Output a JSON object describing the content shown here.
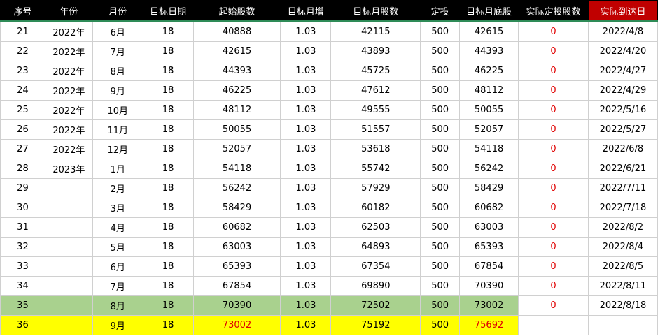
{
  "columns": [
    "序号",
    "年份",
    "月份",
    "目标日期",
    "起始股数",
    "目标月增",
    "目标月股数",
    "定投",
    "目标月底股",
    "实际定投股数",
    "实际到达日"
  ],
  "rows": [
    {
      "seq": "21",
      "year": "2022年",
      "month": "6月",
      "target_date": "18",
      "start_shares": "40888",
      "monthly_growth": "1.03",
      "target_month_shares": "42115",
      "invest": "500",
      "month_end_target": "42615",
      "actual_invest_shares": "0",
      "actual_date": "2022/4/8"
    },
    {
      "seq": "22",
      "year": "2022年",
      "month": "7月",
      "target_date": "18",
      "start_shares": "42615",
      "monthly_growth": "1.03",
      "target_month_shares": "43893",
      "invest": "500",
      "month_end_target": "44393",
      "actual_invest_shares": "0",
      "actual_date": "2022/4/20"
    },
    {
      "seq": "23",
      "year": "2022年",
      "month": "8月",
      "target_date": "18",
      "start_shares": "44393",
      "monthly_growth": "1.03",
      "target_month_shares": "45725",
      "invest": "500",
      "month_end_target": "46225",
      "actual_invest_shares": "0",
      "actual_date": "2022/4/27"
    },
    {
      "seq": "24",
      "year": "2022年",
      "month": "9月",
      "target_date": "18",
      "start_shares": "46225",
      "monthly_growth": "1.03",
      "target_month_shares": "47612",
      "invest": "500",
      "month_end_target": "48112",
      "actual_invest_shares": "0",
      "actual_date": "2022/4/29"
    },
    {
      "seq": "25",
      "year": "2022年",
      "month": "10月",
      "target_date": "18",
      "start_shares": "48112",
      "monthly_growth": "1.03",
      "target_month_shares": "49555",
      "invest": "500",
      "month_end_target": "50055",
      "actual_invest_shares": "0",
      "actual_date": "2022/5/16"
    },
    {
      "seq": "26",
      "year": "2022年",
      "month": "11月",
      "target_date": "18",
      "start_shares": "50055",
      "monthly_growth": "1.03",
      "target_month_shares": "51557",
      "invest": "500",
      "month_end_target": "52057",
      "actual_invest_shares": "0",
      "actual_date": "2022/5/27"
    },
    {
      "seq": "27",
      "year": "2022年",
      "month": "12月",
      "target_date": "18",
      "start_shares": "52057",
      "monthly_growth": "1.03",
      "target_month_shares": "53618",
      "invest": "500",
      "month_end_target": "54118",
      "actual_invest_shares": "0",
      "actual_date": "2022/6/8"
    },
    {
      "seq": "28",
      "year": "2023年",
      "month": "1月",
      "target_date": "18",
      "start_shares": "54118",
      "monthly_growth": "1.03",
      "target_month_shares": "55742",
      "invest": "500",
      "month_end_target": "56242",
      "actual_invest_shares": "0",
      "actual_date": "2022/6/21"
    },
    {
      "seq": "29",
      "year": "",
      "month": "2月",
      "target_date": "18",
      "start_shares": "56242",
      "monthly_growth": "1.03",
      "target_month_shares": "57929",
      "invest": "500",
      "month_end_target": "58429",
      "actual_invest_shares": "0",
      "actual_date": "2022/7/11"
    },
    {
      "seq": "30",
      "year": "",
      "month": "3月",
      "target_date": "18",
      "start_shares": "58429",
      "monthly_growth": "1.03",
      "target_month_shares": "60182",
      "invest": "500",
      "month_end_target": "60682",
      "actual_invest_shares": "0",
      "actual_date": "2022/7/18"
    },
    {
      "seq": "31",
      "year": "",
      "month": "4月",
      "target_date": "18",
      "start_shares": "60682",
      "monthly_growth": "1.03",
      "target_month_shares": "62503",
      "invest": "500",
      "month_end_target": "63003",
      "actual_invest_shares": "0",
      "actual_date": "2022/8/2"
    },
    {
      "seq": "32",
      "year": "",
      "month": "5月",
      "target_date": "18",
      "start_shares": "63003",
      "monthly_growth": "1.03",
      "target_month_shares": "64893",
      "invest": "500",
      "month_end_target": "65393",
      "actual_invest_shares": "0",
      "actual_date": "2022/8/4"
    },
    {
      "seq": "33",
      "year": "",
      "month": "6月",
      "target_date": "18",
      "start_shares": "65393",
      "monthly_growth": "1.03",
      "target_month_shares": "67354",
      "invest": "500",
      "month_end_target": "67854",
      "actual_invest_shares": "0",
      "actual_date": "2022/8/5"
    },
    {
      "seq": "34",
      "year": "",
      "month": "7月",
      "target_date": "18",
      "start_shares": "67854",
      "monthly_growth": "1.03",
      "target_month_shares": "69890",
      "invest": "500",
      "month_end_target": "70390",
      "actual_invest_shares": "0",
      "actual_date": "2022/8/11"
    },
    {
      "seq": "35",
      "year": "",
      "month": "8月",
      "target_date": "18",
      "start_shares": "70390",
      "monthly_growth": "1.03",
      "target_month_shares": "72502",
      "invest": "500",
      "month_end_target": "73002",
      "actual_invest_shares": "0",
      "actual_date": "2022/8/18"
    },
    {
      "seq": "36",
      "year": "",
      "month": "9月",
      "target_date": "18",
      "start_shares": "73002",
      "monthly_growth": "1.03",
      "target_month_shares": "75192",
      "invest": "500",
      "month_end_target": "75692",
      "actual_invest_shares": "",
      "actual_date": ""
    }
  ],
  "highlights": {
    "green_row": "35",
    "yellow_row": "36",
    "green_fill": "#a9d18e",
    "yellow_fill": "#ffff00",
    "header_bg": "#000000",
    "actual_date_header_bg": "#c00000",
    "alert_text_color": "#e00000"
  }
}
